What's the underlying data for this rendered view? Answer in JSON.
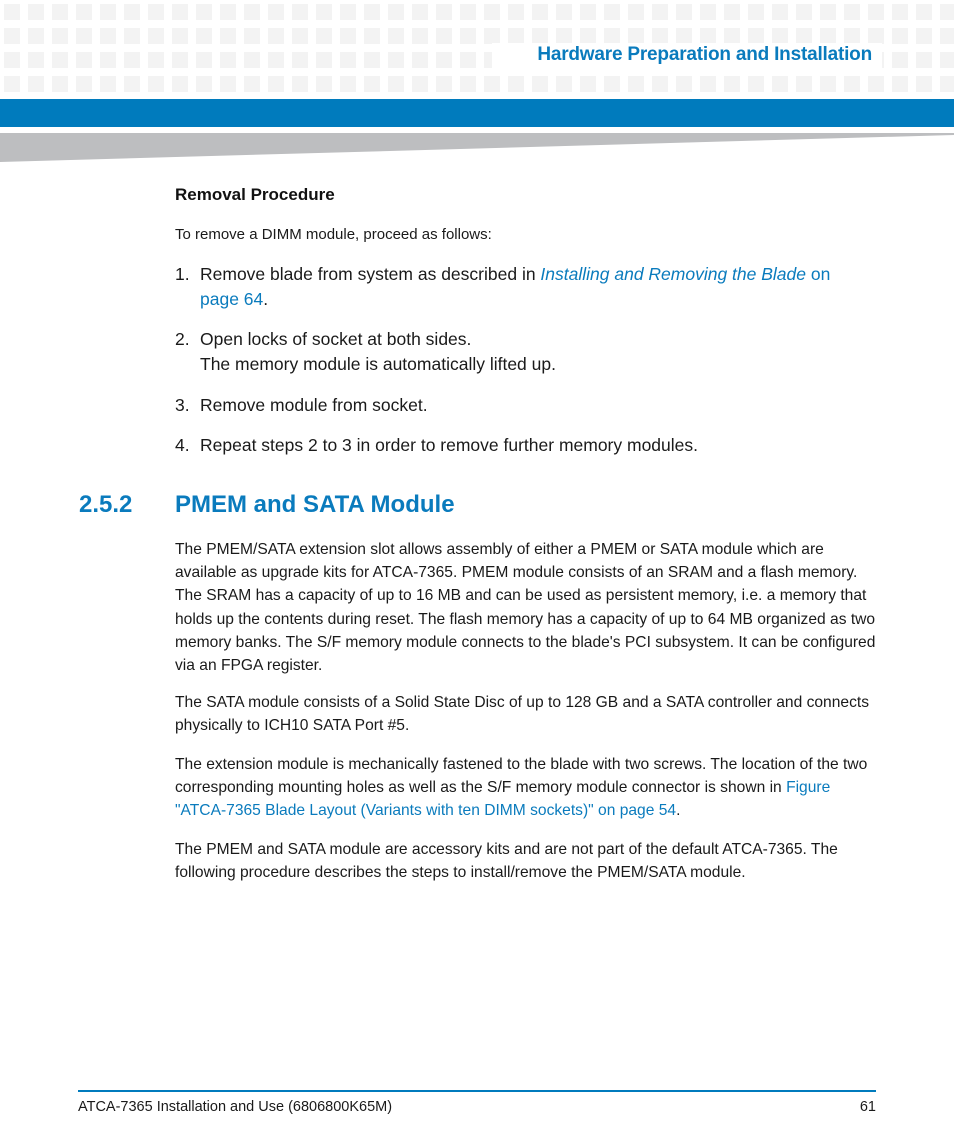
{
  "header": {
    "title": "Hardware Preparation and Installation",
    "accent_color": "#007bbd"
  },
  "removal": {
    "heading": "Removal Procedure",
    "intro": "To remove a DIMM module, proceed as follows:",
    "steps": [
      {
        "num": "1.",
        "pre": "Remove blade from system as described in ",
        "link_italic": "Installing and Removing the Blade",
        "link_plain": " on page 64",
        "post": "."
      },
      {
        "num": "2.",
        "line1": "Open locks of socket at both sides.",
        "line2": "The memory module is automatically lifted up."
      },
      {
        "num": "3.",
        "text": "Remove module from socket."
      },
      {
        "num": "4.",
        "text": "Repeat steps 2 to 3 in order to remove further memory modules."
      }
    ]
  },
  "section": {
    "number": "2.5.2",
    "title": "PMEM and SATA Module",
    "paragraphs": [
      "The PMEM/SATA extension slot allows assembly of either a PMEM or SATA module which are available as upgrade kits for ATCA-7365. PMEM module consists of an SRAM and a flash memory. The SRAM has a capacity of up to 16 MB and can be used as persistent memory, i.e. a memory that holds up the contents during reset. The flash memory has a capacity of up to 64 MB organized as two memory banks. The S/F memory module connects to the blade's PCI subsystem. It can be configured via an FPGA register.",
      "The SATA module consists of a Solid State Disc of up to 128 GB and a SATA controller and connects physically to ICH10 SATA Port #5."
    ],
    "para3": {
      "pre": "The extension module is mechanically fastened to the blade with two screws. The location of the two corresponding mounting holes as well as the S/F memory module connector is shown in ",
      "link": "Figure \"ATCA-7365 Blade Layout (Variants with ten DIMM sockets)\" on page 54",
      "post": "."
    },
    "para4": "The PMEM and SATA module are accessory kits and are not part of the default ATCA-7365.  The following procedure describes the steps to install/remove the PMEM/SATA module."
  },
  "footer": {
    "doc_title": "ATCA-7365 Installation and Use (6806800K65M)",
    "page_number": "61"
  }
}
